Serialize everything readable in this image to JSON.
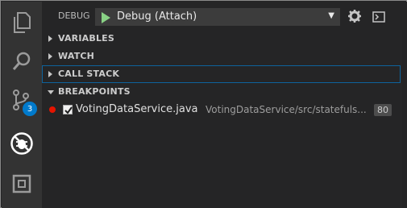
{
  "activity_bar": {
    "items": [
      {
        "name": "explorer-icon"
      },
      {
        "name": "search-icon"
      },
      {
        "name": "source-control-icon",
        "badge": "3"
      },
      {
        "name": "debug-icon"
      },
      {
        "name": "extensions-icon"
      }
    ]
  },
  "debug_toolbar": {
    "label": "DEBUG",
    "configuration": "Debug (Attach)",
    "icons": [
      "start-debug-icon",
      "gear-icon",
      "debug-console-icon"
    ]
  },
  "sections": [
    {
      "title": "VARIABLES",
      "expanded": false
    },
    {
      "title": "WATCH",
      "expanded": false
    },
    {
      "title": "CALL STACK",
      "expanded": false
    },
    {
      "title": "BREAKPOINTS",
      "expanded": true
    }
  ],
  "breakpoints": [
    {
      "checked": true,
      "file": "VotingDataService.java",
      "path": "VotingDataService/src/statefuls...",
      "line": "80"
    }
  ],
  "colors": {
    "accent": "#007acc",
    "breakpoint": "#e51400",
    "play": "#89d185",
    "focus_outline": "#0e639c"
  }
}
